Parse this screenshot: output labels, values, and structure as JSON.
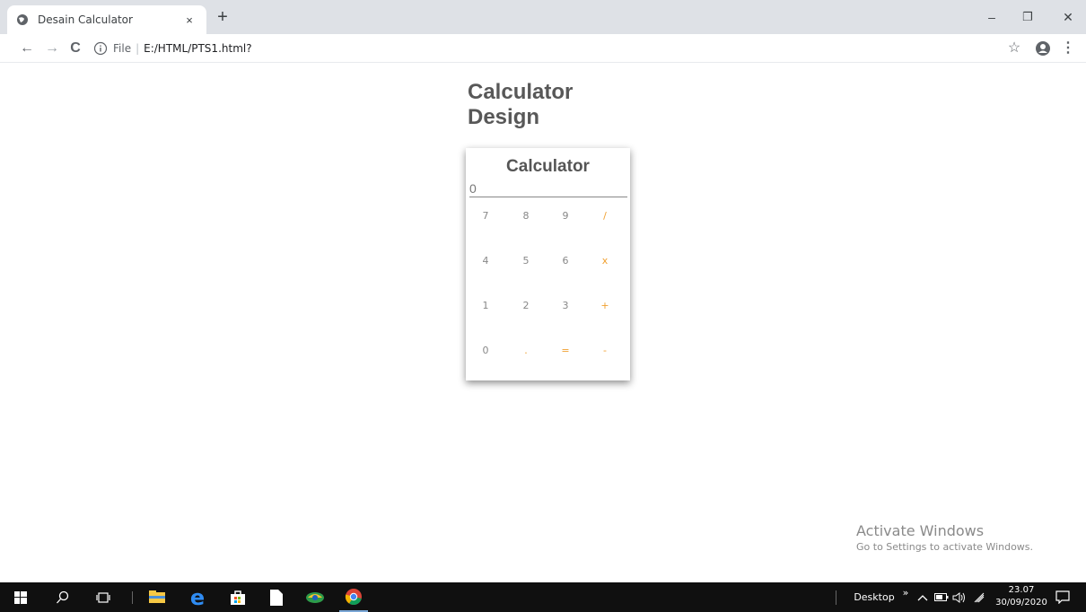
{
  "browser": {
    "tab_title": "Desain Calculator",
    "tab_close": "×",
    "new_tab": "+",
    "minimize": "–",
    "restore": "❐",
    "close": "✕",
    "back": "←",
    "forward": "→",
    "reload": "C",
    "url_scheme": "File",
    "url_path": "E:/HTML/PTS1.html?",
    "bookmark_star": "☆",
    "menu": "⋮"
  },
  "page": {
    "title_line1": "Calculator",
    "title_line2": "Design"
  },
  "calculator": {
    "title": "Calculator",
    "display_value": "0",
    "keys": [
      {
        "label": "7",
        "type": "num"
      },
      {
        "label": "8",
        "type": "num"
      },
      {
        "label": "9",
        "type": "num"
      },
      {
        "label": "/",
        "type": "op"
      },
      {
        "label": "4",
        "type": "num"
      },
      {
        "label": "5",
        "type": "num"
      },
      {
        "label": "6",
        "type": "num"
      },
      {
        "label": "x",
        "type": "op"
      },
      {
        "label": "1",
        "type": "num"
      },
      {
        "label": "2",
        "type": "num"
      },
      {
        "label": "3",
        "type": "num"
      },
      {
        "label": "+",
        "type": "op"
      },
      {
        "label": "0",
        "type": "num"
      },
      {
        "label": ".",
        "type": "op"
      },
      {
        "label": "=",
        "type": "op"
      },
      {
        "label": "-",
        "type": "op"
      }
    ]
  },
  "watermark": {
    "line1": "Activate Windows",
    "line2": "Go to Settings to activate Windows."
  },
  "taskbar": {
    "desktop_label": "Desktop",
    "overflow": "»",
    "chevron": "^",
    "time": "23.07",
    "date": "30/09/2020"
  },
  "colors": {
    "operator_key": "#f0a030",
    "number_key": "#888888",
    "taskbar": "#101010"
  }
}
